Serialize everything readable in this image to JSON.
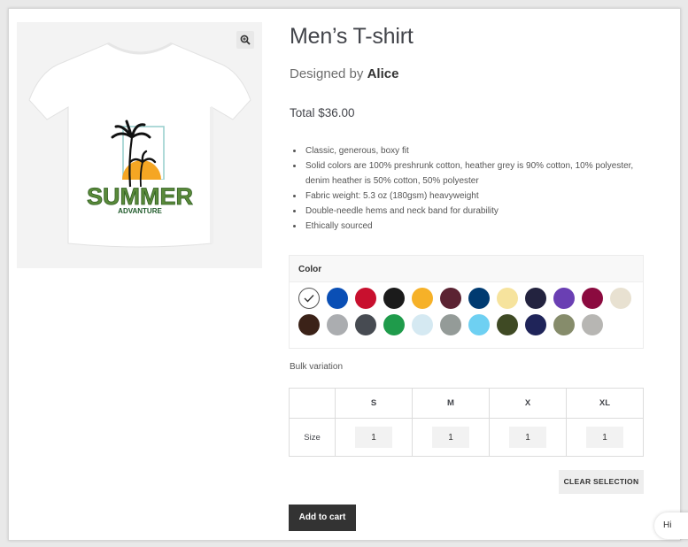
{
  "product": {
    "title": "Men’s T-shirt",
    "designer_prefix": "Designed by",
    "designer_name": "Alice",
    "total": "Total $36.00",
    "features": [
      "Classic, generous, boxy fit",
      "Solid colors are 100% preshrunk cotton, heather grey is 90% cotton, 10% polyester, denim heather is 50% cotton, 50% polyester",
      "Fabric weight: 5.3 oz (180gsm) heavyweight",
      "Double-needle hems and neck band for durability",
      "Ethically sourced"
    ],
    "image": {
      "print_title": "SUMMER",
      "print_subtitle": "ADVANTURE",
      "zoom_icon": "zoom-in-icon"
    }
  },
  "color": {
    "label": "Color",
    "selected_index": 0,
    "swatches": [
      "#ffffff",
      "#0a4fb5",
      "#c8102e",
      "#1b1b1b",
      "#f6b128",
      "#5b2332",
      "#003b71",
      "#f6e39d",
      "#23233f",
      "#6a3fb3",
      "#8b0a3f",
      "#e8e1d1",
      "#3b2218",
      "#abadb0",
      "#474b52",
      "#1f9b4b",
      "#d5e9f2",
      "#949b98",
      "#6ed0f2",
      "#3f4a24",
      "#1f2459",
      "#868c6b",
      "#b7b6b3"
    ]
  },
  "bulk": {
    "label": "Bulk variation",
    "sizes": [
      "S",
      "M",
      "X",
      "XL"
    ],
    "row_label": "Size",
    "quantities": [
      "1",
      "1",
      "1",
      "1"
    ]
  },
  "buttons": {
    "clear": "CLEAR SELECTION",
    "add_to_cart": "Add to cart"
  },
  "chat": {
    "label": "Hi"
  }
}
